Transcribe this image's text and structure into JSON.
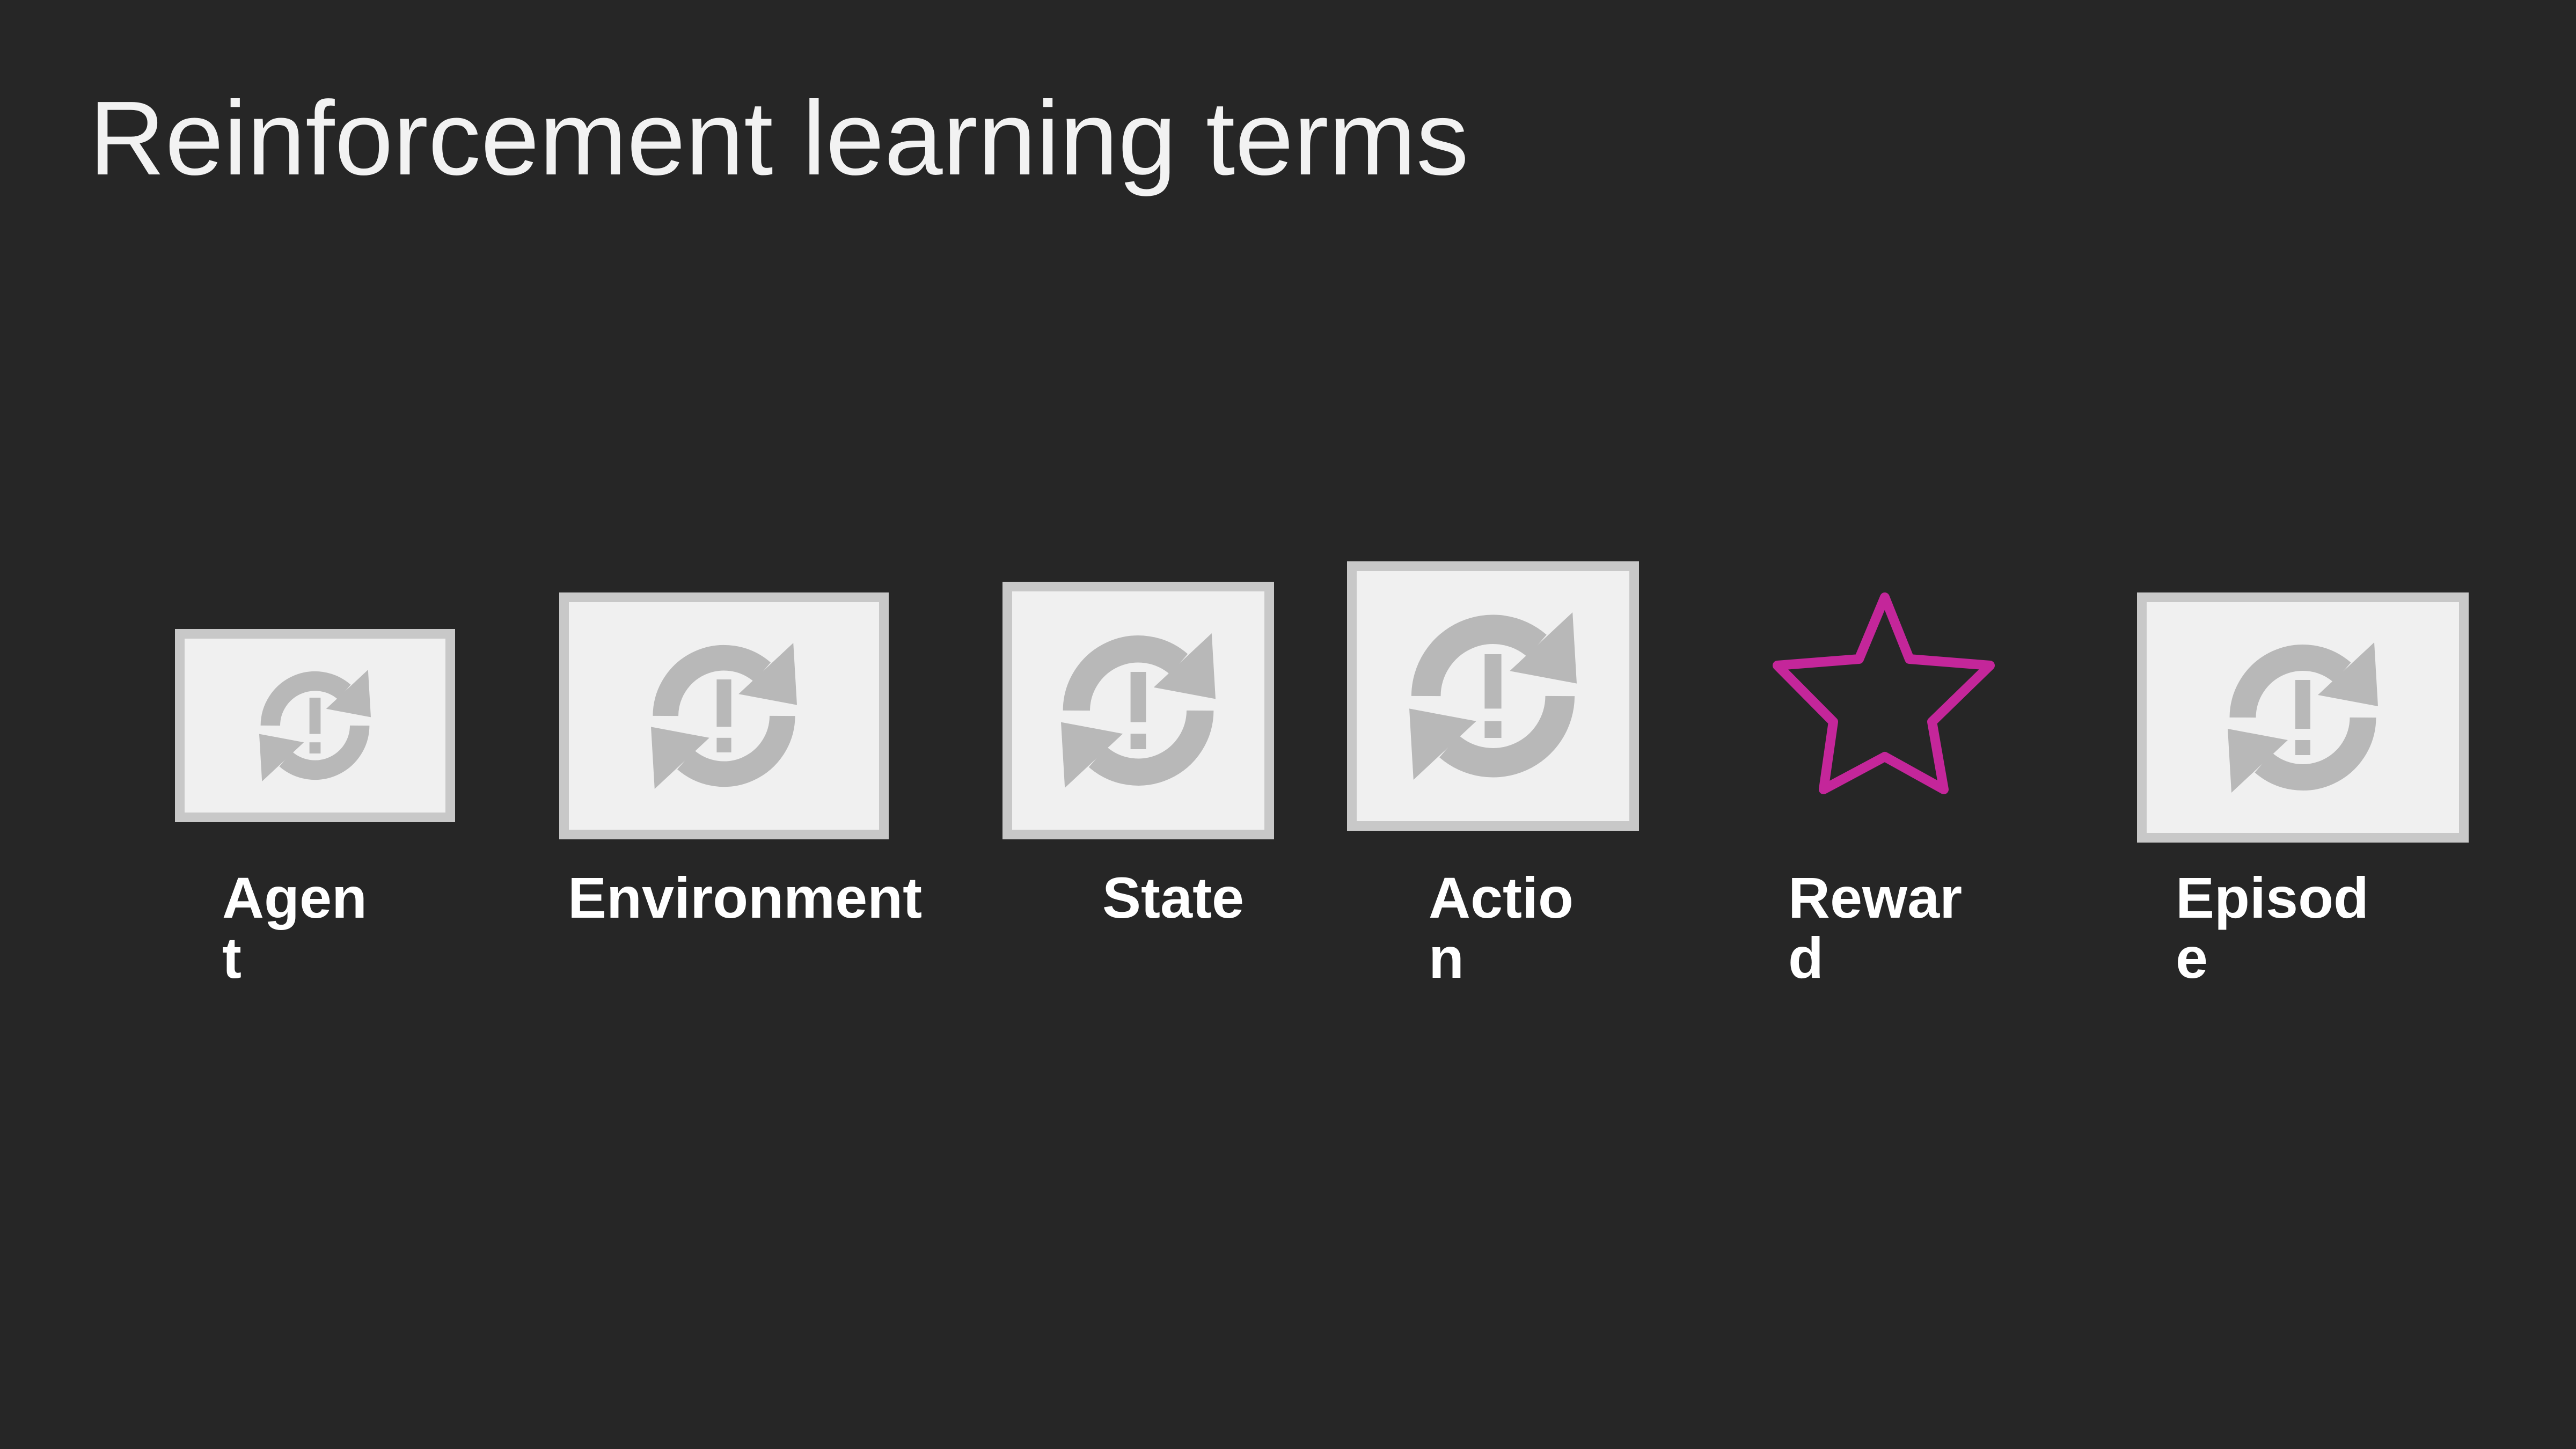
{
  "slide": {
    "title": "Reinforcement learning terms"
  },
  "terms": [
    {
      "label": "Agen\nt",
      "icon": "broken-image-icon"
    },
    {
      "label": "Environment",
      "icon": "broken-image-icon"
    },
    {
      "label": "State",
      "icon": "broken-image-icon"
    },
    {
      "label": "Actio\nn",
      "icon": "broken-image-icon"
    },
    {
      "label": "Rewar\nd",
      "icon": "star-icon"
    },
    {
      "label": "Episod\ne",
      "icon": "broken-image-icon"
    }
  ],
  "colors": {
    "background": "#262626",
    "title_text": "#f2f2f2",
    "label_text": "#ffffff",
    "placeholder_frame": "#c8c8c8",
    "placeholder_fill": "#f0f0f0",
    "placeholder_glyph": "#b8b8b8",
    "star_outline": "#c4269a"
  }
}
